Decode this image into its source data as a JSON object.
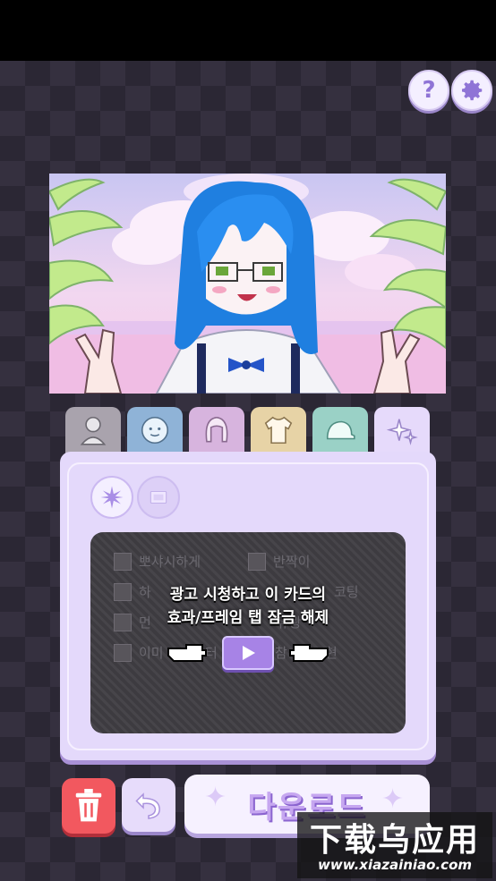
{
  "header": {
    "help_icon": "question-mark-icon",
    "settings_icon": "gear-icon",
    "help_label": "?"
  },
  "scene": {
    "description_icon": "character-preview"
  },
  "tabs": [
    {
      "icon": "silhouette-icon",
      "color": "#a9a3ad"
    },
    {
      "icon": "face-icon",
      "color": "#8fb3d7"
    },
    {
      "icon": "hair-icon",
      "color": "#d7b4de"
    },
    {
      "icon": "shirt-icon",
      "color": "#e7d3a6"
    },
    {
      "icon": "cap-icon",
      "color": "#9ad1c6"
    },
    {
      "icon": "sparkles-icon",
      "color": "#e6dafb",
      "selected": true
    }
  ],
  "panel": {
    "options": [
      {
        "label": "뽀샤시하게"
      },
      {
        "label": "반짝이"
      },
      {
        "label": "하"
      },
      {
        "label": "코팅"
      },
      {
        "label": "먼"
      },
      {
        "label": "유광"
      },
      {
        "label": "이미"
      },
      {
        "label": "터"
      },
      {
        "label": "참"
      },
      {
        "label": "현"
      }
    ],
    "unlock_line_1": "광고 시청하고 이 카드의",
    "unlock_line_2": "효과/프레임 탭 잠금 해제"
  },
  "footer": {
    "download_label": "다운로드"
  },
  "watermark": {
    "title": "下载乌应用",
    "url": "www.xiazainiao.com"
  }
}
